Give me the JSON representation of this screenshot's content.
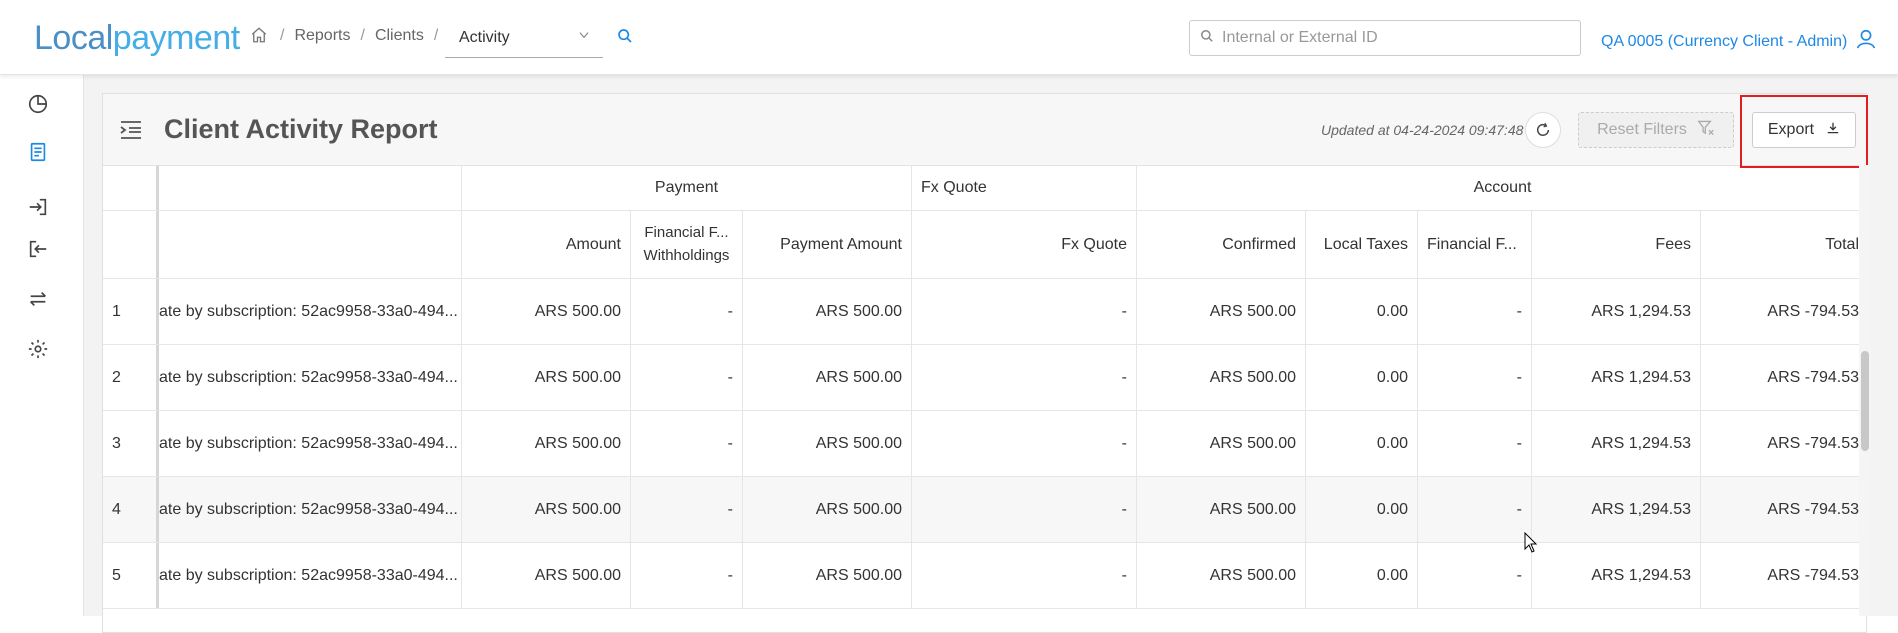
{
  "logo": {
    "part1": "Local",
    "part2": "payment"
  },
  "breadcrumb": {
    "items": [
      "Reports",
      "Clients"
    ],
    "current": "Activity"
  },
  "search": {
    "placeholder": "Internal or External ID"
  },
  "account": {
    "label": "QA 0005 (Currency Client - Admin)"
  },
  "sidebar": {
    "icons": [
      "pie-chart-icon",
      "document-icon",
      "login-icon",
      "logout-icon",
      "transfer-icon",
      "gear-icon"
    ]
  },
  "report": {
    "title": "Client Activity Report",
    "updated": "Updated at 04-24-2024 09:47:48",
    "reset_label": "Reset Filters",
    "export_label": "Export"
  },
  "table": {
    "groups": {
      "payment": "Payment",
      "fxquote": "Fx Quote",
      "account": "Account"
    },
    "columns": {
      "amount": "Amount",
      "financial_withholdings_1": "Financial F...",
      "financial_withholdings_2": "Withholdings",
      "payment_amount": "Payment Amount",
      "fx_quote": "Fx Quote",
      "confirmed": "Confirmed",
      "local_taxes": "Local Taxes",
      "financial_f": "Financial F...",
      "fees": "Fees",
      "total": "Total"
    },
    "rows": [
      {
        "idx": "1",
        "desc": "ate by subscription: 52ac9958-33a0-494...",
        "amount": "ARS 500.00",
        "fin_with": "-",
        "pay_amount": "ARS 500.00",
        "fx": "-",
        "confirmed": "ARS 500.00",
        "taxes": "0.00",
        "fin_f": "-",
        "fees": "ARS 1,294.53",
        "total": "ARS -794.53"
      },
      {
        "idx": "2",
        "desc": "ate by subscription: 52ac9958-33a0-494...",
        "amount": "ARS 500.00",
        "fin_with": "-",
        "pay_amount": "ARS 500.00",
        "fx": "-",
        "confirmed": "ARS 500.00",
        "taxes": "0.00",
        "fin_f": "-",
        "fees": "ARS 1,294.53",
        "total": "ARS -794.53"
      },
      {
        "idx": "3",
        "desc": "ate by subscription: 52ac9958-33a0-494...",
        "amount": "ARS 500.00",
        "fin_with": "-",
        "pay_amount": "ARS 500.00",
        "fx": "-",
        "confirmed": "ARS 500.00",
        "taxes": "0.00",
        "fin_f": "-",
        "fees": "ARS 1,294.53",
        "total": "ARS -794.53"
      },
      {
        "idx": "4",
        "desc": "ate by subscription: 52ac9958-33a0-494...",
        "amount": "ARS 500.00",
        "fin_with": "-",
        "pay_amount": "ARS 500.00",
        "fx": "-",
        "confirmed": "ARS 500.00",
        "taxes": "0.00",
        "fin_f": "-",
        "fees": "ARS 1,294.53",
        "total": "ARS -794.53"
      },
      {
        "idx": "5",
        "desc": "ate by subscription: 52ac9958-33a0-494...",
        "amount": "ARS 500.00",
        "fin_with": "-",
        "pay_amount": "ARS 500.00",
        "fx": "-",
        "confirmed": "ARS 500.00",
        "taxes": "0.00",
        "fin_f": "-",
        "fees": "ARS 1,294.53",
        "total": "ARS -794.53"
      }
    ]
  },
  "colors": {
    "brand_blue": "#1e88e5",
    "highlight_red": "#e02020"
  }
}
